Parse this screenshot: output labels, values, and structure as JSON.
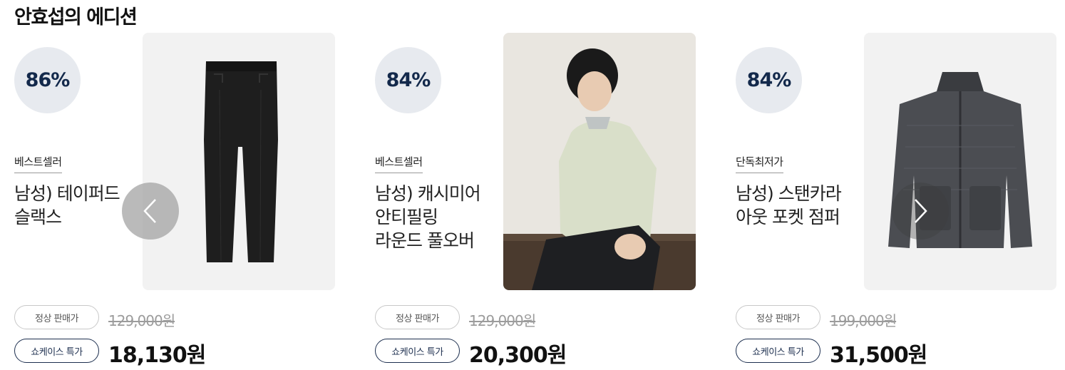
{
  "section": {
    "title": "안효섭의 에디션"
  },
  "nav": {
    "prev_icon": "chevron-left-icon",
    "next_icon": "chevron-right-icon"
  },
  "products": [
    {
      "discount": "86%",
      "tag": "베스트셀러",
      "name_lines": [
        "남성) 테이퍼드",
        "슬랙스"
      ],
      "regular_label": "정상 판매가",
      "original_price": "129,000원",
      "showcase_label": "쇼케이스 특가",
      "sale_price": "18,130원",
      "image": "black-tapered-slacks"
    },
    {
      "discount": "84%",
      "tag": "베스트셀러",
      "name_lines": [
        "남성) 캐시미어",
        "안티필링",
        "라운드 풀오버"
      ],
      "regular_label": "정상 판매가",
      "original_price": "129,000원",
      "showcase_label": "쇼케이스 특가",
      "sale_price": "20,300원",
      "image": "model-in-cashmere-pullover"
    },
    {
      "discount": "84%",
      "tag": "단독최저가",
      "name_lines": [
        "남성) 스탠카라",
        "아웃 포켓 점퍼"
      ],
      "regular_label": "정상 판매가",
      "original_price": "199,000원",
      "showcase_label": "쇼케이스 특가",
      "sale_price": "31,500원",
      "image": "charcoal-quilted-jumper"
    }
  ]
}
